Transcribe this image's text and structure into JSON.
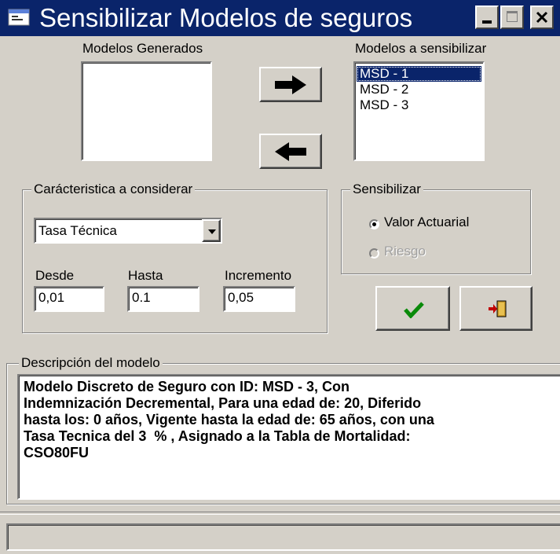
{
  "window": {
    "title": "Sensibilizar Modelos de seguros"
  },
  "titlebar": {
    "minimize_icon": "minimize-icon",
    "maximize_icon": "maximize-icon",
    "close_icon": "close-icon"
  },
  "left_list": {
    "label": "Modelos Generados",
    "items": []
  },
  "right_list": {
    "label": "Modelos a sensibilizar",
    "items": [
      "MSD - 1",
      "MSD - 2",
      "MSD - 3"
    ],
    "selected_index": 0
  },
  "move_right_icon": "arrow-right-icon",
  "move_left_icon": "arrow-left-icon",
  "caracteristica": {
    "group_label": "Carácteristica a considerar",
    "combo_value": "Tasa Técnica",
    "desde_label": "Desde",
    "hasta_label": "Hasta",
    "incremento_label": "Incremento",
    "desde_value": "0,01",
    "hasta_value": "0.1",
    "incremento_value": "0,05"
  },
  "sensibilizar": {
    "group_label": "Sensibilizar",
    "option1": "Valor Actuarial",
    "option2": "Riesgo",
    "selected": "Valor Actuarial"
  },
  "buttons": {
    "ok_icon": "checkmark-icon",
    "exit_icon": "exit-door-icon"
  },
  "descripcion": {
    "group_label": "Descripción del modelo",
    "text": "Modelo Discreto de Seguro con ID: MSD - 3, Con\nIndemnización Decremental, Para una edad de: 20, Diferido\nhasta los: 0 años, Vigente hasta la edad de: 65 años, con una\nTasa Tecnica del 3  % , Asignado a la Tabla de Mortalidad:\nCSO80FU"
  },
  "status_bar": {
    "text": ""
  }
}
